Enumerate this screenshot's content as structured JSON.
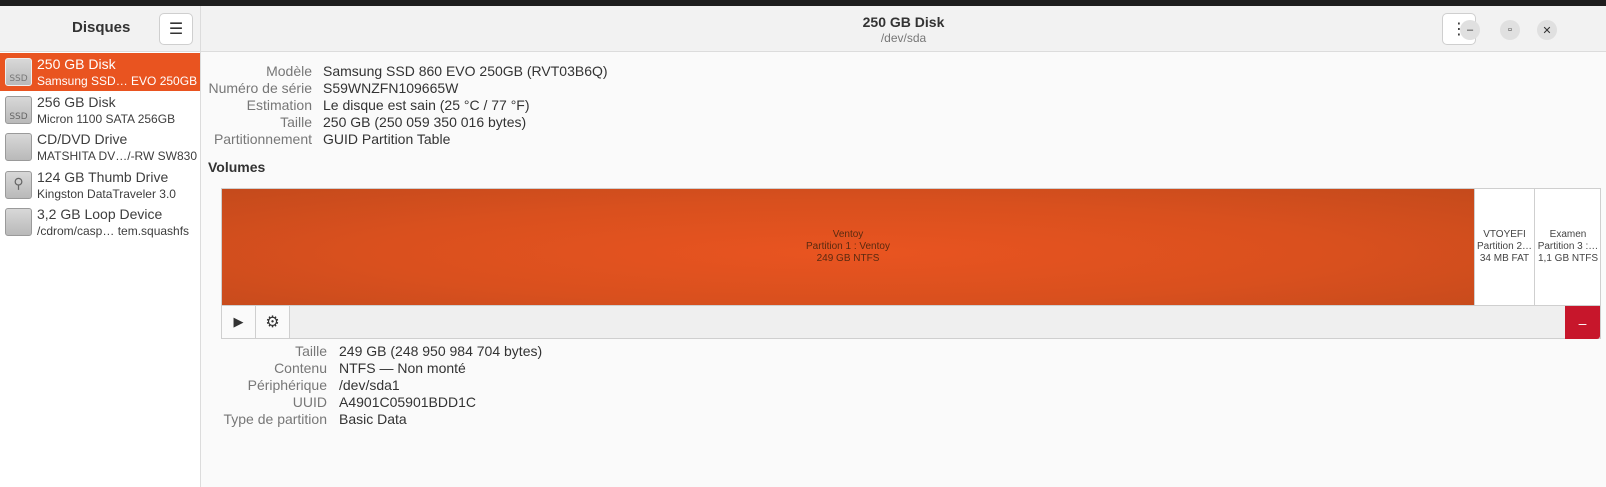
{
  "sidebar": {
    "title": "Disques",
    "disks": [
      {
        "name": "250 GB Disk",
        "sub": "Samsung SSD…  EVO 250GB",
        "icon": "ssd-icon",
        "icon_text": "SSD"
      },
      {
        "name": "256 GB Disk",
        "sub": "Micron 1100 SATA 256GB",
        "icon": "ssd-icon",
        "icon_text": "SSD"
      },
      {
        "name": "CD/DVD Drive",
        "sub": "MATSHITA DV…/-RW SW830",
        "icon": "optical-drive-icon",
        "icon_text": ""
      },
      {
        "name": "124 GB Thumb Drive",
        "sub": "Kingston DataTraveler 3.0",
        "icon": "usb-drive-icon",
        "icon_text": "⚲"
      },
      {
        "name": "3,2 GB Loop Device",
        "sub": "/cdrom/casp…  tem.squashfs",
        "icon": "loop-device-icon",
        "icon_text": ""
      }
    ]
  },
  "header": {
    "title": "250 GB Disk",
    "subtitle": "/dev/sda"
  },
  "disk_info": [
    {
      "label": "Modèle",
      "value": "Samsung SSD 860 EVO 250GB (RVT03B6Q)"
    },
    {
      "label": "Numéro de série",
      "value": "S59WNZFN109665W"
    },
    {
      "label": "Estimation",
      "value": "Le disque est sain (25 °C / 77 °F)"
    },
    {
      "label": "Taille",
      "value": "250 GB (250 059 350 016 bytes)"
    },
    {
      "label": "Partitionnement",
      "value": "GUID Partition Table"
    }
  ],
  "volumes": {
    "title": "Volumes",
    "partitions": [
      {
        "line1": "Ventoy",
        "line2": "Partition 1 : Ventoy",
        "line3": "249 GB NTFS"
      },
      {
        "line1": "VTOYEFI",
        "line2": "Partition 2…",
        "line3": "34 MB FAT"
      },
      {
        "line1": "Examen",
        "line2": "Partition 3 :…",
        "line3": "1,1 GB NTFS"
      }
    ]
  },
  "volume_info": [
    {
      "label": "Taille",
      "value": "249 GB (248 950 984 704 bytes)"
    },
    {
      "label": "Contenu",
      "value": "NTFS — Non monté"
    },
    {
      "label": "Périphérique",
      "value": "/dev/sda1"
    },
    {
      "label": "UUID",
      "value": "A4901C05901BDD1C"
    },
    {
      "label": "Type de partition",
      "value": "Basic Data"
    }
  ],
  "colors": {
    "accent": "#e95420",
    "delete": "#c7162b"
  }
}
